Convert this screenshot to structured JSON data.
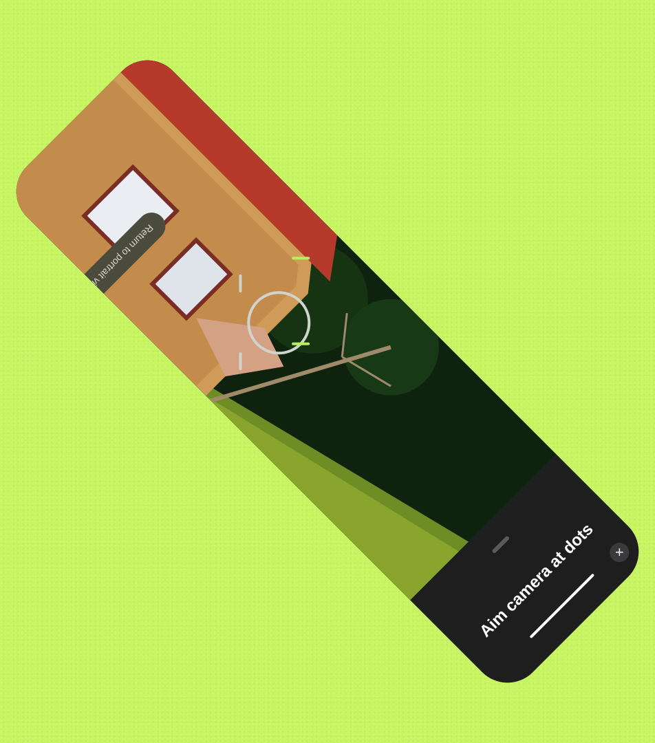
{
  "camera": {
    "return_button_label": "Return to portrait view"
  },
  "panel": {
    "instruction": "Aim camera at dots",
    "add_icon_glyph": "+"
  },
  "colors": {
    "background": "#c7f562",
    "panel": "#1e1e1f",
    "accent": "#b8f05a"
  },
  "icons": {
    "reticle": "focus-reticle-icon",
    "add": "plus-icon",
    "handle": "drag-handle-icon"
  }
}
